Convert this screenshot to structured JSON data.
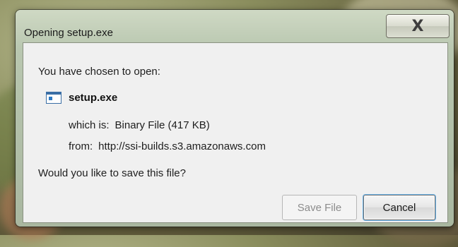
{
  "window": {
    "title": "Opening setup.exe",
    "close_symbol": "X"
  },
  "dialog": {
    "prompt": "You have chosen to open:",
    "file": {
      "icon": "application-file-icon",
      "name": "setup.exe"
    },
    "type_label": "which is:",
    "type_value": "Binary File (417 KB)",
    "from_label": "from:",
    "from_value": "http://ssi-builds.s3.amazonaws.com",
    "question": "Would you like to save this file?"
  },
  "buttons": {
    "save_label": "Save File",
    "cancel_label": "Cancel"
  }
}
